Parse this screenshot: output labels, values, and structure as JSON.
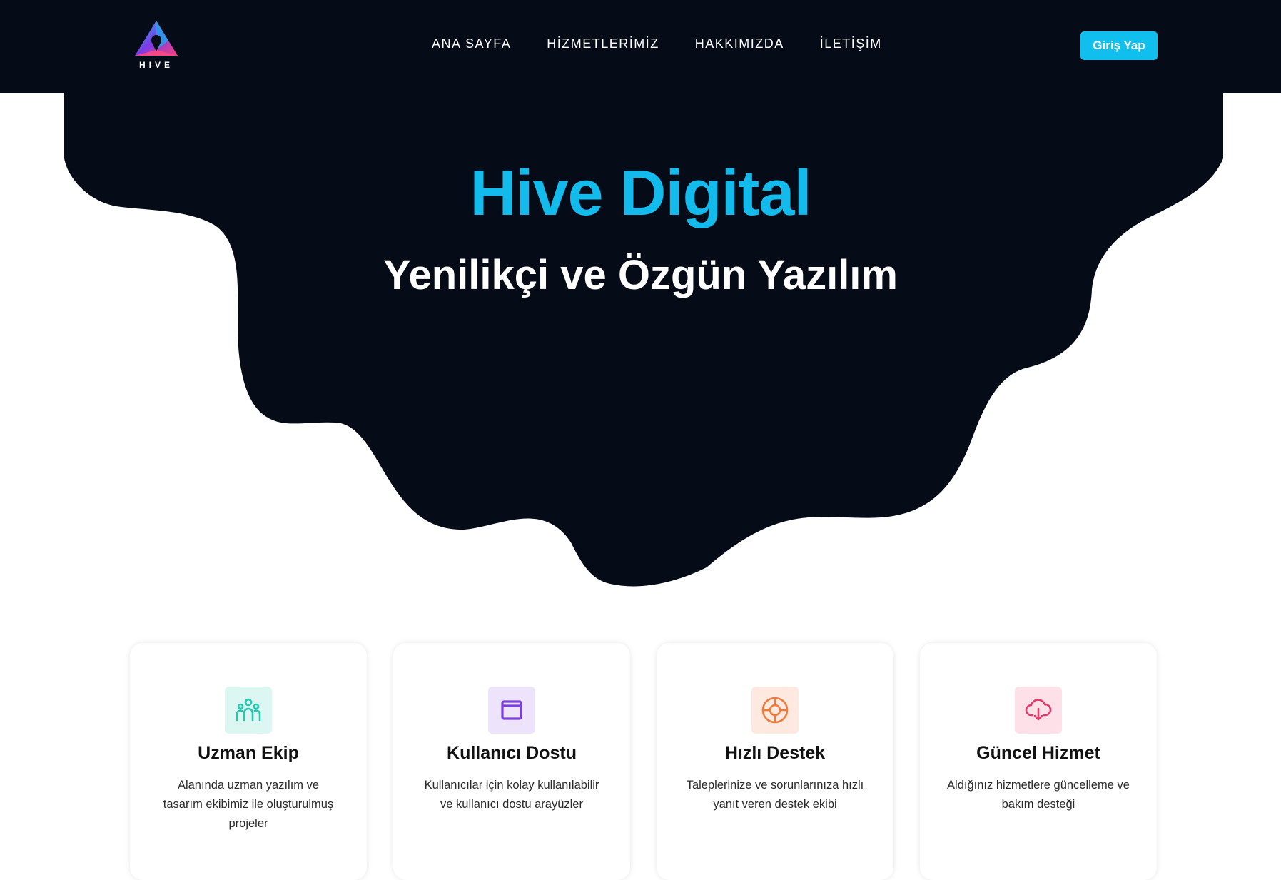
{
  "brand": {
    "logo_text": "HIVE"
  },
  "nav": {
    "links": [
      "ANA SAYFA",
      "HİZMETLERİMİZ",
      "HAKKIMIZDA",
      "İLETİŞİM"
    ],
    "login_label": "Giriş Yap"
  },
  "hero": {
    "title": "Hive Digital",
    "subtitle": "Yenilikçi ve Özgün Yazılım"
  },
  "features": [
    {
      "icon": "team-icon",
      "icon_color": "#22c7b0",
      "icon_bg": "#dcf7f2",
      "title": "Uzman Ekip",
      "description": "Alanında uzman yazılım ve tasarım ekibimiz ile oluşturulmuş projeler"
    },
    {
      "icon": "window-icon",
      "icon_color": "#7b3fe0",
      "icon_bg": "#ede3fb",
      "title": "Kullanıcı Dostu",
      "description": "Kullanıcılar için kolay kullanılabilir ve kullanıcı dostu arayüzler"
    },
    {
      "icon": "lifebuoy-icon",
      "icon_color": "#f07a3c",
      "icon_bg": "#fde9df",
      "title": "Hızlı Destek",
      "description": "Taleplerinize ve sorunlarınıza hızlı yanıt veren destek ekibi"
    },
    {
      "icon": "cloud-download-icon",
      "icon_color": "#e33a6c",
      "icon_bg": "#fde0e8",
      "title": "Güncel Hizmet",
      "description": "Aldığınız hizmetlere güncelleme ve bakım desteği"
    }
  ],
  "colors": {
    "dark": "#050b17",
    "accent": "#11bfee"
  }
}
